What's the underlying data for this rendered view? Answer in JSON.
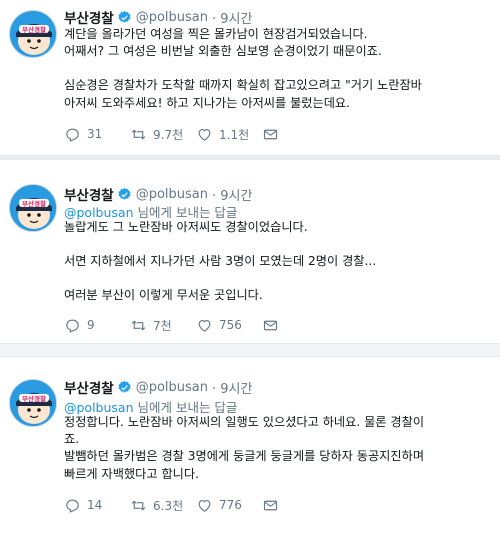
{
  "account": {
    "display_name": "부산경찰",
    "handle": "@polbusan",
    "avatar_text": "부산경찰"
  },
  "tweets": [
    {
      "time": "· 9시간",
      "reply_prefix": "",
      "reply_suffix": "",
      "lines": [
        "계단을 올라가던 여성을 찍은 몰카남이 현장검거되었습니다.",
        "어째서? 그 여성은 비번날 외출한 심보영 순경이었기 때문이죠.",
        "",
        "심순경은 경찰차가 도착할 때까지 확실히 잡고있으려고 \"거기 노란잠바",
        "아저씨 도와주세요! 하고 지나가는 아저씨를 불렀는데요."
      ],
      "replies": "31",
      "retweets": "9.7천",
      "likes": "1.1천"
    },
    {
      "time": "· 9시간",
      "reply_mention": "@polbusan",
      "reply_suffix": " 님에게 보내는 답글",
      "lines": [
        "놀랍게도 그 노란잠바 아저씨도 경찰이었습니다.",
        "",
        "서면 지하철에서 지나가던 사람 3명이 모였는데 2명이 경찰...",
        "",
        "여러분 부산이 이렇게 무서운 곳입니다."
      ],
      "replies": "9",
      "retweets": "7천",
      "likes": "756"
    },
    {
      "time": "· 9시간",
      "reply_mention": "@polbusan",
      "reply_suffix": " 님에게 보내는 답글",
      "lines": [
        "정정합니다. 노란잠바 아저씨의 일행도 있으셨다고 하네요. 물론 경찰이",
        "죠.",
        "발뺌하던 몰카범은 경찰 3명에게 둥글게 둥글게를 당하자 동공지진하며",
        "빠르게 자백했다고 합니다."
      ],
      "replies": "14",
      "retweets": "6.3천",
      "likes": "776"
    }
  ],
  "icons": {
    "verified": "verified-badge-icon",
    "reply": "reply-icon",
    "retweet": "retweet-icon",
    "like": "heart-icon",
    "dm": "envelope-icon"
  },
  "colors": {
    "verified": "#1da1f2",
    "link": "#1b95e0",
    "secondary": "#657786",
    "avatar_bg": "#1da1f2"
  }
}
